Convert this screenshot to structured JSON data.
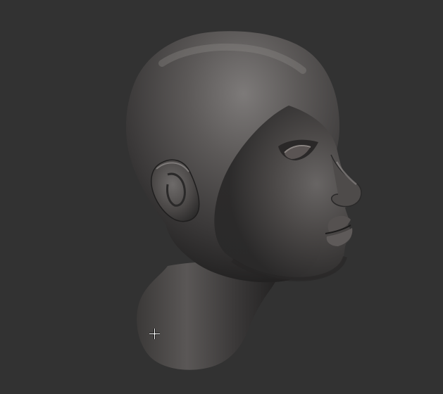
{
  "viewport": {
    "background": "#323232",
    "model": {
      "name": "sculpted-head-model",
      "material_color": "#4a4746",
      "highlight_color": "#8a8684",
      "shadow_color": "#1c1b1b"
    },
    "cursor": {
      "icon": "crosshair-cursor-icon",
      "color": "#ffffff"
    }
  }
}
